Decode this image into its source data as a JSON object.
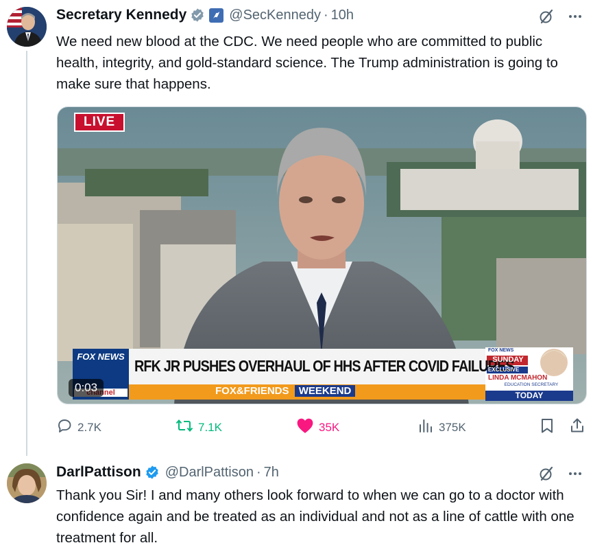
{
  "tweet1": {
    "name": "Secretary Kennedy",
    "handle": "@SecKennedy",
    "separator": "·",
    "time": "10h",
    "text": "We need new blood at the CDC. We need people who are committed to public health, integrity, and gold-standard science. The Trump administration is going to make sure that happens.",
    "media": {
      "live_badge": "LIVE",
      "headline": "RFK JR PUSHES OVERHAUL OF HHS AFTER COVID FAILURES",
      "channel_logo": "FOX NEWS",
      "channel_small": "channel",
      "show_name": "FOX&FRIENDS",
      "show_suffix": "WEEKEND",
      "promo_network": "FOX NEWS",
      "promo_day": "SUNDAY",
      "promo_tag": "EXCLUSIVE",
      "promo_guest": "LINDA MCMAHON",
      "promo_title": "EDUCATION SECRETARY",
      "promo_when": "TODAY",
      "video_time": "0:03"
    },
    "stats": {
      "replies": "2.7K",
      "reposts": "7.1K",
      "likes": "35K",
      "views": "375K"
    }
  },
  "tweet2": {
    "name": "DarlPattison",
    "handle": "@DarlPattison",
    "separator": "·",
    "time": "7h",
    "text": "Thank you Sir! I and many others look forward to when we can go to a doctor with confidence again and be treated as an individual and not as a line of cattle with one treatment for all."
  },
  "colors": {
    "verified_blue": "#1d9bf0",
    "like_pink": "#f91880",
    "repost_green": "#00ba7c",
    "secondary_text": "#536471"
  }
}
